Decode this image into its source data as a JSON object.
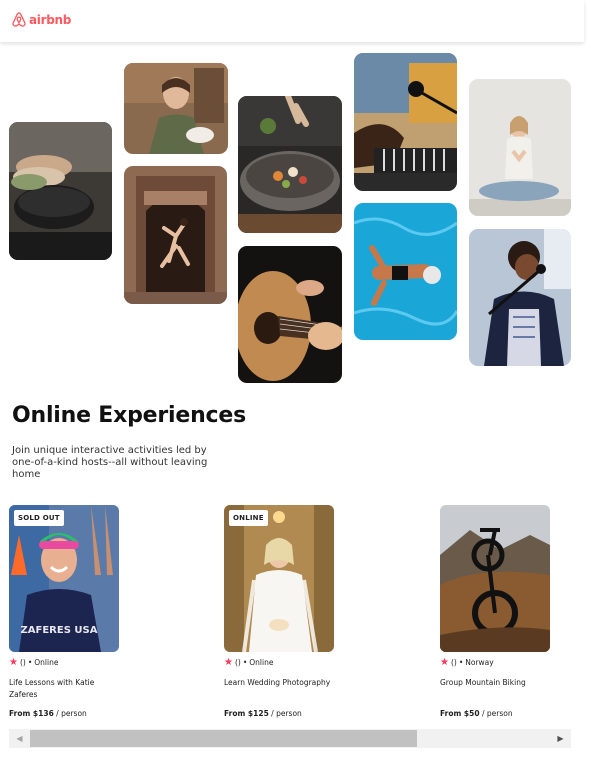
{
  "brand": {
    "name": "airbnb",
    "color": "#ff5a5f"
  },
  "gallery": [
    {
      "subject": "cooking class pans on stove"
    },
    {
      "subject": "smiling chef holding dish"
    },
    {
      "subject": "dancer in ornate doorway"
    },
    {
      "subject": "chef garnishing bowl of food"
    },
    {
      "subject": "hands playing acoustic guitar"
    },
    {
      "subject": "musician at keyboard with microphone"
    },
    {
      "subject": "swimmer in blue pool"
    },
    {
      "subject": "woman meditating in yoga pose"
    },
    {
      "subject": "singer performing at microphone"
    }
  ],
  "section": {
    "title": "Online Experiences",
    "subtitle": "Join unique interactive activities led by one-of-a-kind hosts--all without leaving home"
  },
  "cards": [
    {
      "badge": "SOLD OUT",
      "rating": "()",
      "location": "Online",
      "title": "Life Lessons with Katie Zaferes",
      "price_prefix": "From $136",
      "price_suffix": " / person",
      "suit_text": "ZAFERES USA"
    },
    {
      "badge": "ONLINE",
      "rating": "()",
      "location": "Online",
      "title": "Learn Wedding Photography",
      "price_prefix": "From $125",
      "price_suffix": " / person"
    },
    {
      "badge": "",
      "rating": "()",
      "location": "Norway",
      "title": "Group Mountain Biking",
      "price_prefix": "From $50",
      "price_suffix": " / person"
    }
  ],
  "icons": {
    "logo": "airbnb-logo-icon",
    "star": "star-icon",
    "scroll_left": "scroll-left-arrow-icon",
    "scroll_right": "scroll-right-arrow-icon"
  },
  "scroll": {
    "left_arrow": "◀",
    "right_arrow": "▶",
    "dot": "•",
    "star": "★"
  }
}
